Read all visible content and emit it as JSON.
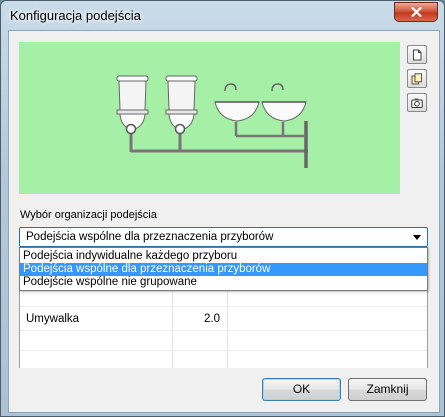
{
  "window": {
    "title": "Konfiguracja podejścia",
    "close_label": "✕"
  },
  "preview": {
    "background_color": "#a6efa6",
    "fixtures": [
      "toilet",
      "toilet",
      "washbasin",
      "washbasin"
    ]
  },
  "side_toolbar": {
    "buttons": [
      {
        "icon": "new-document-icon"
      },
      {
        "icon": "copy-icon"
      },
      {
        "icon": "camera-icon"
      }
    ]
  },
  "organization": {
    "label": "Wybór organizacji podejścia",
    "selected": "Podejścia wspólne dla przeznaczenia przyborów",
    "options": [
      "Podejścia indywidualne każdego przyboru",
      "Podejścia wspólne dla przeznaczenia przyborów",
      "Podejście wspólne nie grupowane"
    ],
    "highlighted_index": 1
  },
  "table": {
    "rows": [
      {
        "name": "Umywalka",
        "value": "2.0"
      }
    ]
  },
  "footer": {
    "ok_label": "OK",
    "close_label": "Zamknij"
  },
  "colors": {
    "selection": "#3399ff",
    "pipe": "#707070",
    "close_button": "#c9462b"
  }
}
